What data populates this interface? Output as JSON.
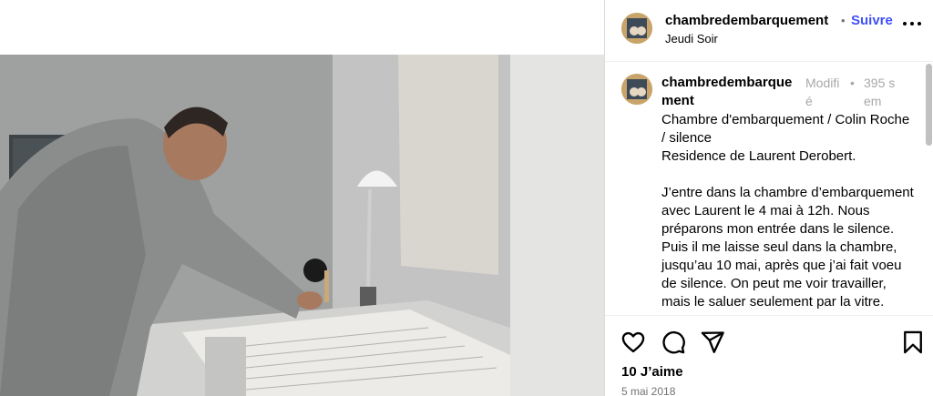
{
  "post": {
    "author": "chambredembarquement",
    "follow_label": "Suivre",
    "separator": "•",
    "location": "Jeudi Soir",
    "caption": {
      "username": "chambredembarquement",
      "edited_label": "Modifié",
      "separator": "•",
      "time_ago": "395 sem",
      "text": "Chambre d'embarquement / Colin Roche / silence\nResidence de Laurent Derobert.\n\nJ’entre dans la chambre d’embarquement avec Laurent le 4 mai à 12h. Nous préparons mon entrée dans le silence. Puis il me laisse seul dans la chambre, jusqu’au 10 mai, après que j’ai fait voeu de silence. On peut me voir travailler, mais le saluer seulement par la vitre."
    },
    "likes": "10 J’aime",
    "date": "5 mai 2018"
  },
  "icons": {
    "more": "more-options-icon",
    "like": "heart-icon",
    "comment": "comment-icon",
    "share": "share-icon",
    "save": "bookmark-icon"
  },
  "colors": {
    "follow": "#4150f7",
    "muted": "#a8a8a8",
    "date": "#737373"
  }
}
